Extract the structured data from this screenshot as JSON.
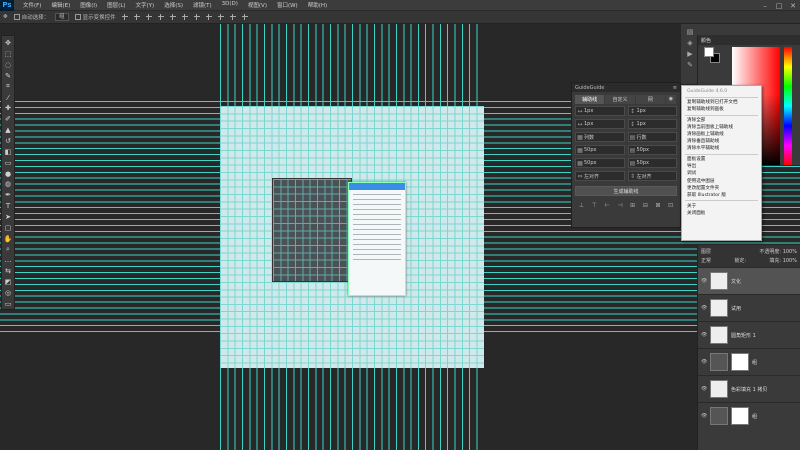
{
  "app": {
    "logo": "Ps"
  },
  "menubar": [
    "文件(F)",
    "编辑(E)",
    "图像(I)",
    "图层(L)",
    "文字(Y)",
    "选择(S)",
    "滤镜(T)",
    "3D(D)",
    "视图(V)",
    "窗口(W)",
    "帮助(H)"
  ],
  "window_controls": [
    "–",
    "□",
    "✕"
  ],
  "options": {
    "auto_select": "自动选择：",
    "auto_select_target": "组",
    "show_transform": "显示变换控件"
  },
  "guideguide": {
    "title": "GuideGuide",
    "tabs": [
      "辅助线",
      "自定义",
      "网"
    ],
    "fields": [
      {
        "icon": "↔",
        "value": "1px"
      },
      {
        "icon": "↕",
        "value": "1px"
      },
      {
        "icon": "↔",
        "value": "1px"
      },
      {
        "icon": "↕",
        "value": "1px"
      },
      {
        "icon": "▦",
        "value": "列数"
      },
      {
        "icon": "▤",
        "value": "行数"
      },
      {
        "icon": "▦",
        "value": "50px"
      },
      {
        "icon": "▤",
        "value": "50px"
      },
      {
        "icon": "▦",
        "value": "50px"
      },
      {
        "icon": "▤",
        "value": "50px"
      },
      {
        "icon": "⇔",
        "value": "左对齐"
      },
      {
        "icon": "⇕",
        "value": "左对齐"
      }
    ],
    "button": "生成辅助线",
    "bottom_icons": [
      "⊥",
      "⊤",
      "⊢",
      "⊣",
      "⊞",
      "⊟",
      "⊠",
      "⊡"
    ]
  },
  "context_menu": {
    "items": [
      {
        "label": "GuideGuide 4.6.0",
        "disabled": true
      },
      {
        "sep": true
      },
      {
        "label": "复制辅助线到已打开文档"
      },
      {
        "label": "复制辅助线到画板"
      },
      {
        "sep": true
      },
      {
        "label": "清除全部"
      },
      {
        "label": "清除当前图板上辅助线"
      },
      {
        "label": "清除画板上辅助线"
      },
      {
        "label": "清除垂直辅助线"
      },
      {
        "label": "清除水平辅助线"
      },
      {
        "sep": true
      },
      {
        "label": "面板设置"
      },
      {
        "label": "导出"
      },
      {
        "label": "调试"
      },
      {
        "label": "使用选中图层"
      },
      {
        "label": "更改配置文件夹"
      },
      {
        "label": "获取 Illustrator 版"
      },
      {
        "sep": true
      },
      {
        "label": "关于"
      },
      {
        "label": "关闭面板"
      }
    ]
  },
  "color_panel": {
    "tab": "颜色"
  },
  "layers_panel": {
    "tab": "图层",
    "opacity_label": "不透明度: 100%",
    "fill_label": "填充: 100%",
    "mode": "正常",
    "lock_label": "锁定:",
    "layers": [
      {
        "name": "文化",
        "mask": false,
        "selected": true
      },
      {
        "name": "试用",
        "mask": false
      },
      {
        "name": "圆角矩形 1",
        "mask": false
      },
      {
        "name": "组",
        "mask": true
      },
      {
        "name": "色彩填充 1 拷贝",
        "mask": false
      },
      {
        "name": "组",
        "mask": true
      }
    ]
  },
  "mock_menu": {
    "lines": 14
  }
}
